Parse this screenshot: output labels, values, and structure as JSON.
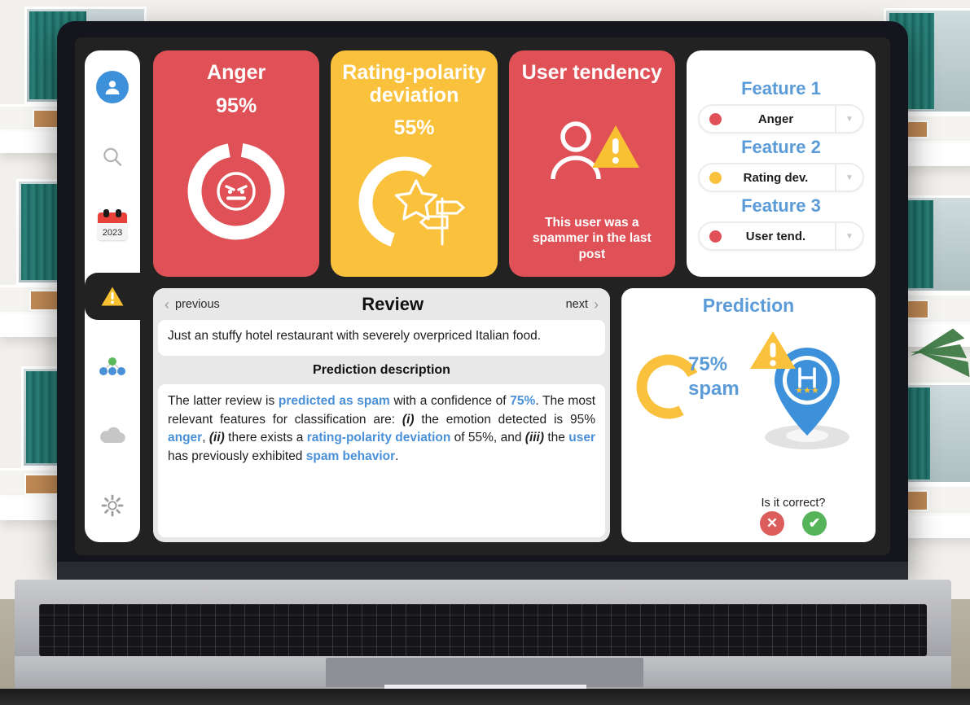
{
  "colors": {
    "red": "#df5157",
    "yellow": "#f9c13c",
    "blue": "#5b9bd8",
    "panel_dark": "#222222",
    "green": "#55b45a",
    "vote_red": "#dd5c5c"
  },
  "sidebar": {
    "items": [
      {
        "icon": "user-avatar-icon",
        "label": "Profile",
        "active": false
      },
      {
        "icon": "search-icon",
        "label": "Search",
        "active": false
      },
      {
        "icon": "calendar-icon",
        "label": "Calendar",
        "year": "2023",
        "active": false
      },
      {
        "icon": "warning-triangle-icon",
        "label": "Alerts",
        "active": true
      },
      {
        "icon": "network-nodes-icon",
        "label": "Network",
        "active": false
      },
      {
        "icon": "cloud-icon",
        "label": "Cloud",
        "active": false
      },
      {
        "icon": "gear-icon",
        "label": "Settings",
        "active": false
      }
    ]
  },
  "metrics": [
    {
      "title": "Anger",
      "value": "95%",
      "percent": 95,
      "color": "#df5157",
      "graphic": "angry-face-donut"
    },
    {
      "title": "Rating-polarity deviation",
      "value": "55%",
      "percent": 55,
      "color": "#f9c13c",
      "graphic": "star-signpost-donut"
    },
    {
      "title": "User tendency",
      "value": "",
      "note": "This user was a spammer in the last post",
      "color": "#df5157",
      "graphic": "person-warning"
    }
  ],
  "selector": {
    "features": [
      {
        "label": "Feature 1",
        "value": "Anger",
        "dot_color": "#df5157"
      },
      {
        "label": "Feature 2",
        "value": "Rating dev.",
        "dot_color": "#f9c13c"
      },
      {
        "label": "Feature 3",
        "value": "User tend.",
        "dot_color": "#df5157"
      }
    ],
    "arrow_glyph": "▼"
  },
  "review": {
    "previous_label": "previous",
    "next_label": "next",
    "title": "Review",
    "text": "Just an stuffy hotel restaurant with severely overpriced Italian food.",
    "description_header": "Prediction description",
    "description_parts": [
      {
        "t": "The latter review is ",
        "style": "plain"
      },
      {
        "t": "predicted as spam",
        "style": "hl"
      },
      {
        "t": " with a confidence of ",
        "style": "plain"
      },
      {
        "t": "75%",
        "style": "hl"
      },
      {
        "t": ". The most relevant features for classification are: ",
        "style": "plain"
      },
      {
        "t": "(i)",
        "style": "it"
      },
      {
        "t": " the emotion detected is 95% ",
        "style": "plain"
      },
      {
        "t": "anger",
        "style": "hl"
      },
      {
        "t": ", ",
        "style": "plain"
      },
      {
        "t": "(ii)",
        "style": "it"
      },
      {
        "t": " there exists a ",
        "style": "plain"
      },
      {
        "t": "rating-polarity deviation",
        "style": "hl"
      },
      {
        "t": " of 55%, and ",
        "style": "plain"
      },
      {
        "t": "(iii)",
        "style": "it"
      },
      {
        "t": " the ",
        "style": "plain"
      },
      {
        "t": "user",
        "style": "hl"
      },
      {
        "t": " has previously exhibited ",
        "style": "plain"
      },
      {
        "t": "spam behavior",
        "style": "hl"
      },
      {
        "t": ".",
        "style": "plain"
      }
    ]
  },
  "prediction": {
    "title": "Prediction",
    "percent": 75,
    "percent_label": "75%",
    "class_label": "spam",
    "ask_label": "Is it correct?",
    "reject_glyph": "✕",
    "accept_glyph": "✔",
    "pin_letter": "H",
    "pin_stars": "★★★"
  }
}
